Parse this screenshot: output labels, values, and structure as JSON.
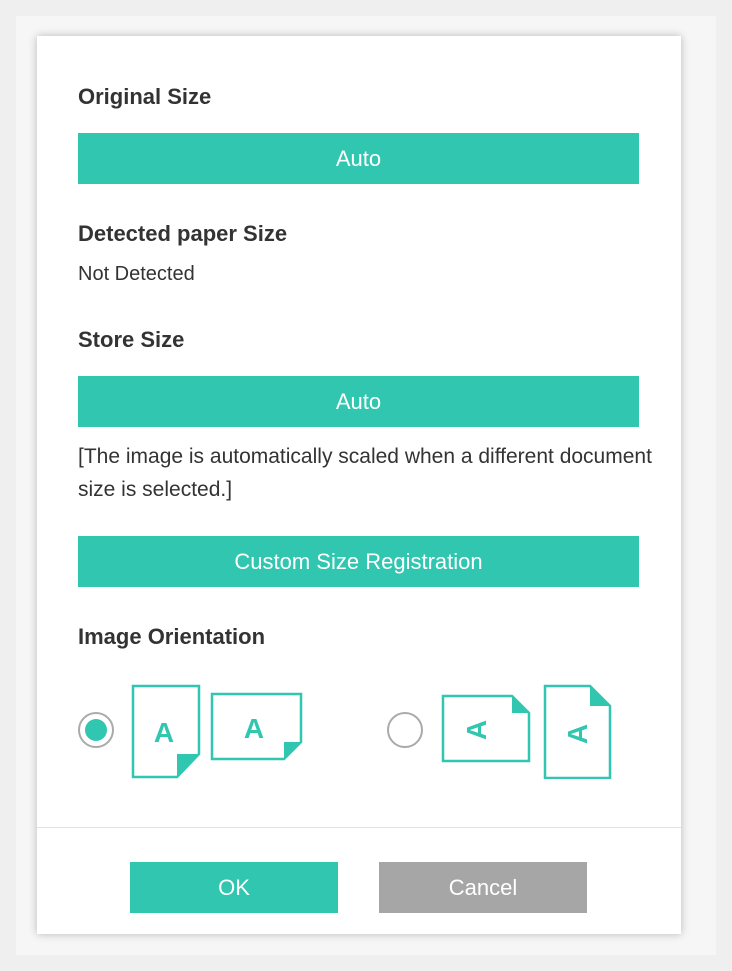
{
  "original_size": {
    "label": "Original Size",
    "value": "Auto"
  },
  "detected_paper_size": {
    "label": "Detected paper Size",
    "value": "Not Detected"
  },
  "store_size": {
    "label": "Store Size",
    "value": "Auto",
    "note": "[The image is automatically scaled when a different document size is selected.]"
  },
  "custom_size_button": "Custom Size Registration",
  "image_orientation": {
    "label": "Image Orientation",
    "options": [
      {
        "name": "upright",
        "selected": true,
        "icon": "orientation-upright-icon"
      },
      {
        "name": "rotated",
        "selected": false,
        "icon": "orientation-rotated-icon"
      }
    ]
  },
  "footer": {
    "ok": "OK",
    "cancel": "Cancel"
  },
  "colors": {
    "accent": "#30c6b0",
    "cancel": "#a6a6a6",
    "text": "#333333"
  }
}
